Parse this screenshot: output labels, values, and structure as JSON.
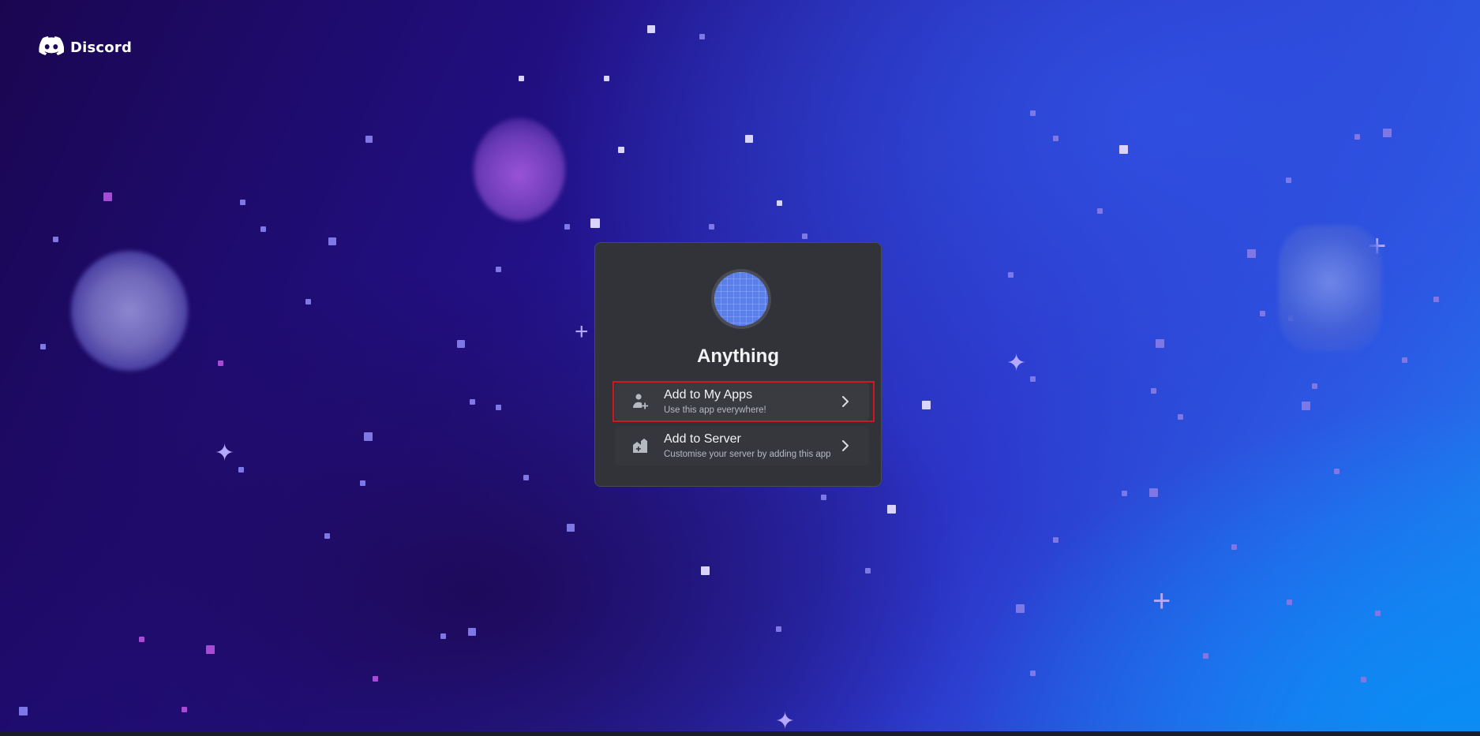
{
  "brand": {
    "name": "Discord",
    "icon": "discord-logo-icon"
  },
  "app": {
    "name": "Anything",
    "avatar_color": "#5b7fe8"
  },
  "options": [
    {
      "title": "Add to My Apps",
      "subtitle": "Use this app everywhere!",
      "icon": "person-add-icon",
      "highlighted": true
    },
    {
      "title": "Add to Server",
      "subtitle": "Customise your server by adding this app",
      "icon": "server-add-icon",
      "highlighted": false
    }
  ],
  "colors": {
    "card_background": "#313338",
    "highlight_border": "#d1171f",
    "text_primary": "#f2f3f5",
    "text_secondary": "#b5bac1"
  }
}
